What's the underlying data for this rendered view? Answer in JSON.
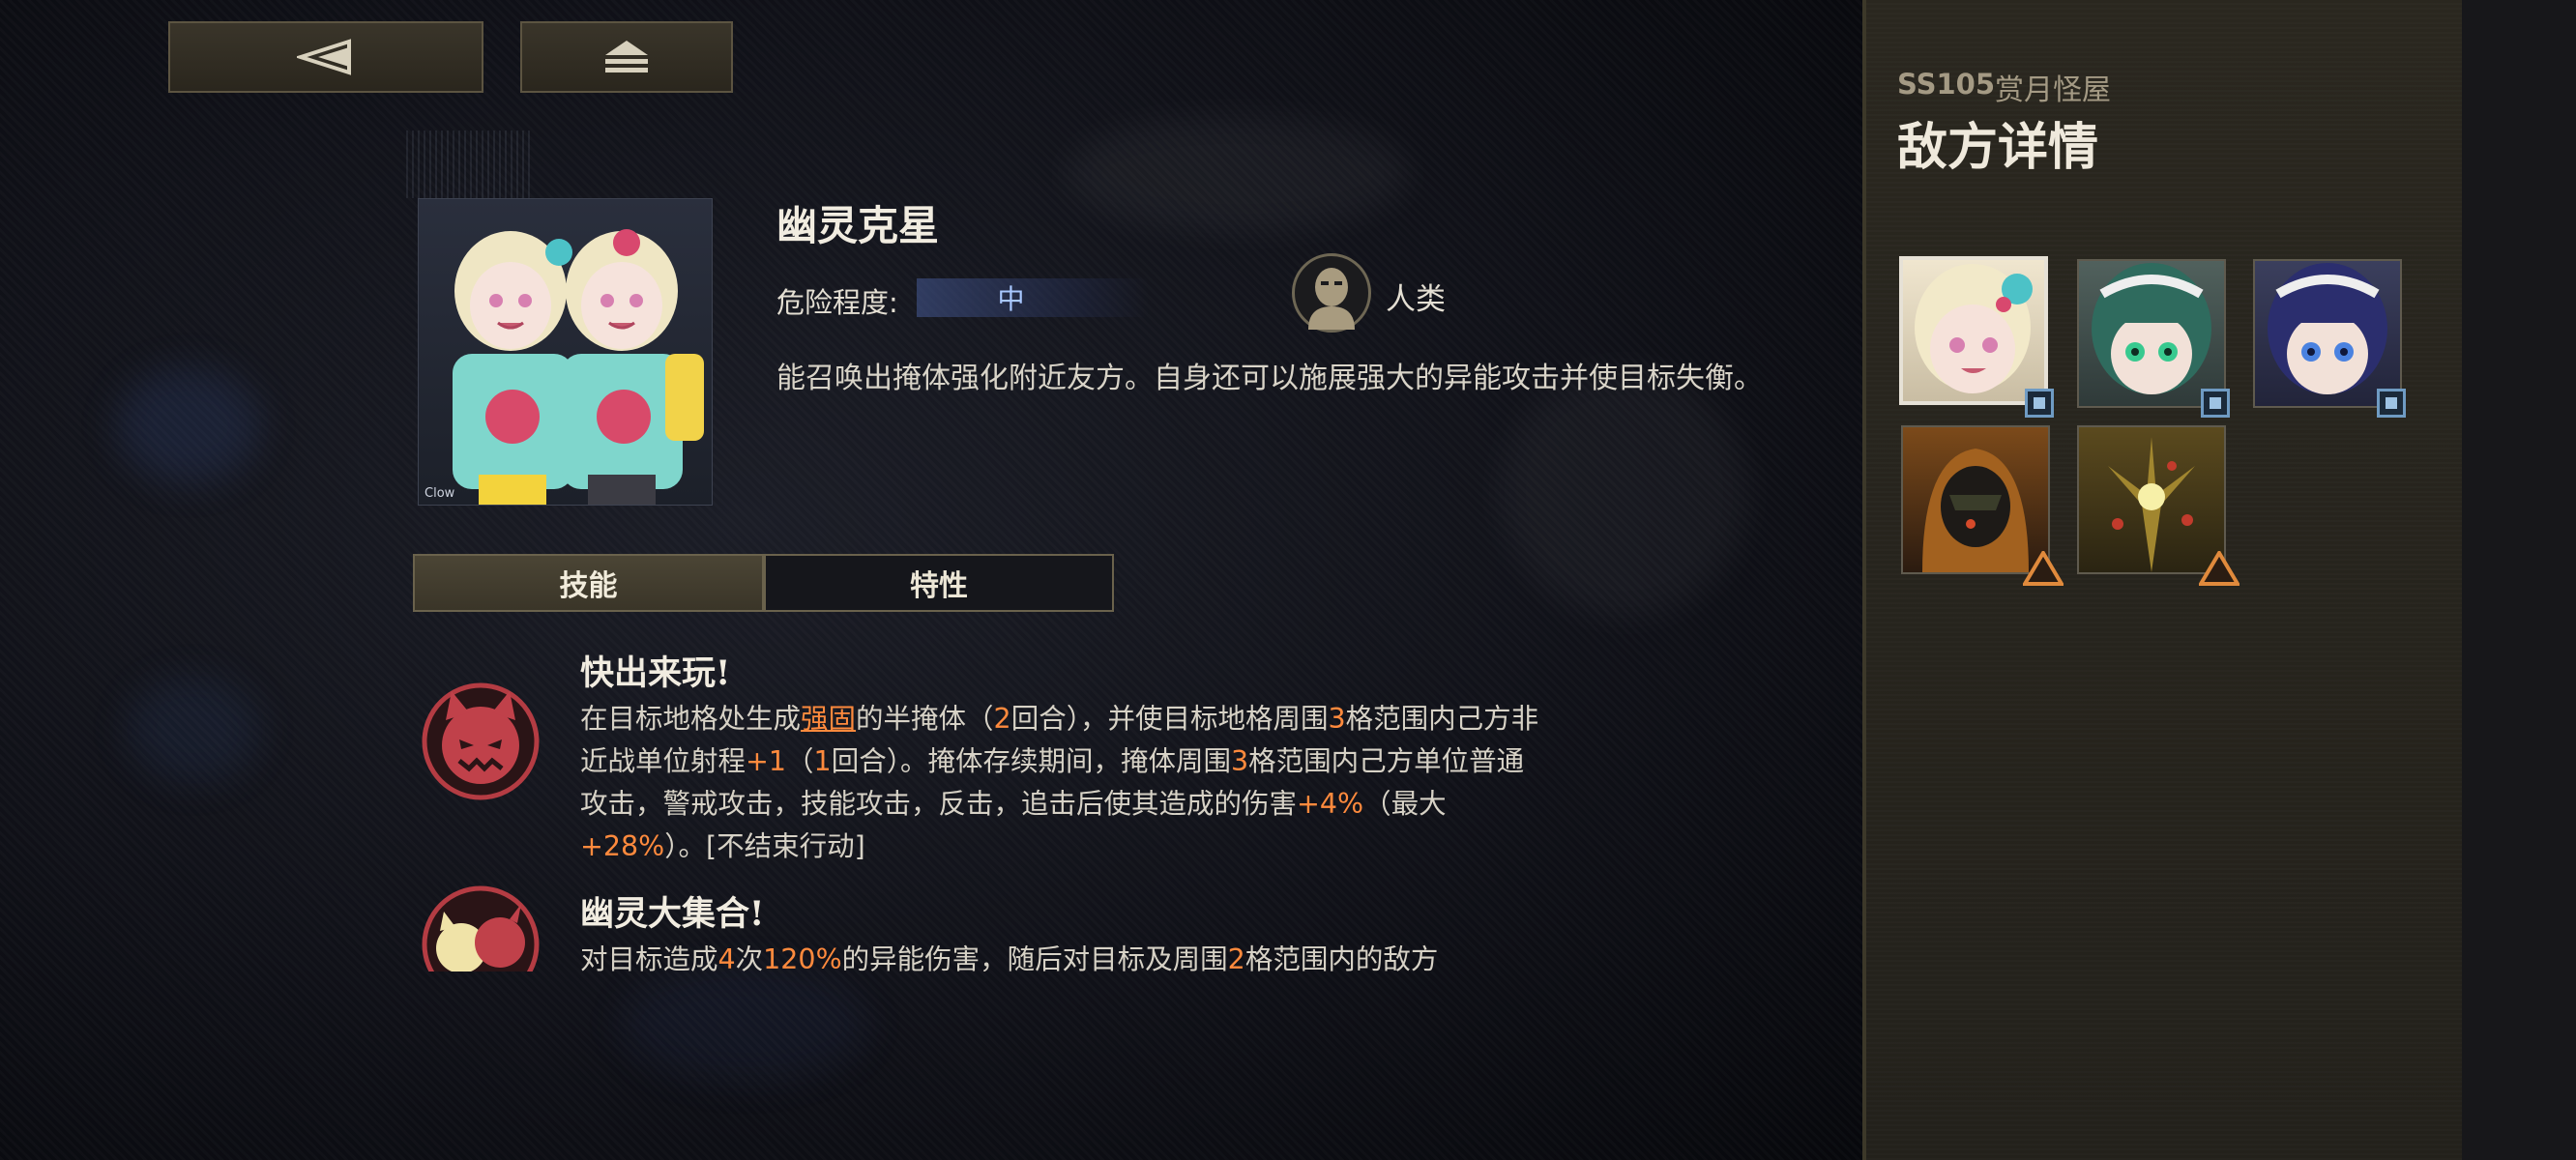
{
  "colors": {
    "highlight": "#ff8a3d",
    "danger_blue": "#a9c8ff",
    "panel_bg": "#2a271f",
    "gold_border": "#6a624c"
  },
  "topbar": {
    "back_icon": "back-triangle-icon",
    "home_icon": "home-stack-icon"
  },
  "enemy": {
    "name": "幽灵克星",
    "danger_label": "危险程度:",
    "danger_value": "中",
    "race": "人类",
    "description": "能召唤出掩体强化附近友方。自身还可以施展强大的异能攻击并使目标失衡。"
  },
  "tabs": [
    {
      "label": "技能",
      "active": true
    },
    {
      "label": "特性",
      "active": false
    }
  ],
  "skills": [
    {
      "title": "快出来玩!",
      "desc_parts": [
        {
          "t": "在目标地格处生成"
        },
        {
          "t": "强固",
          "style": "hl-u"
        },
        {
          "t": "的半掩体（"
        },
        {
          "t": "2",
          "style": "hl"
        },
        {
          "t": "回合），并使目标地格周围"
        },
        {
          "t": "3",
          "style": "hl"
        },
        {
          "t": "格范围内己方非近战单位射程"
        },
        {
          "t": "+1",
          "style": "hl"
        },
        {
          "t": "（"
        },
        {
          "t": "1",
          "style": "hl"
        },
        {
          "t": "回合）。掩体存续期间，掩体周围"
        },
        {
          "t": "3",
          "style": "hl"
        },
        {
          "t": "格范围内己方单位普通攻击，警戒攻击，技能攻击，反击，追击后使其造成的伤害"
        },
        {
          "t": "+4%",
          "style": "hl"
        },
        {
          "t": "（最大"
        },
        {
          "t": "+28%",
          "style": "hl"
        },
        {
          "t": "）。[不结束行动]"
        }
      ]
    },
    {
      "title": "幽灵大集合!",
      "desc_parts": [
        {
          "t": "对目标造成"
        },
        {
          "t": "4",
          "style": "hl"
        },
        {
          "t": "次"
        },
        {
          "t": "120%",
          "style": "hl"
        },
        {
          "t": "的异能伤害，随后对目标及周围"
        },
        {
          "t": "2",
          "style": "hl"
        },
        {
          "t": "格范围内的敌方"
        }
      ]
    }
  ],
  "panel": {
    "stage_code": "SS105",
    "stage_name": "赏月怪屋",
    "title": "敌方详情"
  },
  "enemy_cards": [
    {
      "name": "blonde-twin-girl-portrait",
      "badge": "square",
      "selected": true
    },
    {
      "name": "green-hair-maid-portrait",
      "badge": "square",
      "selected": false
    },
    {
      "name": "blue-hair-maid-portrait",
      "badge": "square",
      "selected": false
    },
    {
      "name": "hooded-soldier-portrait",
      "badge": "triangle",
      "selected": false
    },
    {
      "name": "golden-tree-creature-portrait",
      "badge": "triangle",
      "selected": false
    }
  ]
}
